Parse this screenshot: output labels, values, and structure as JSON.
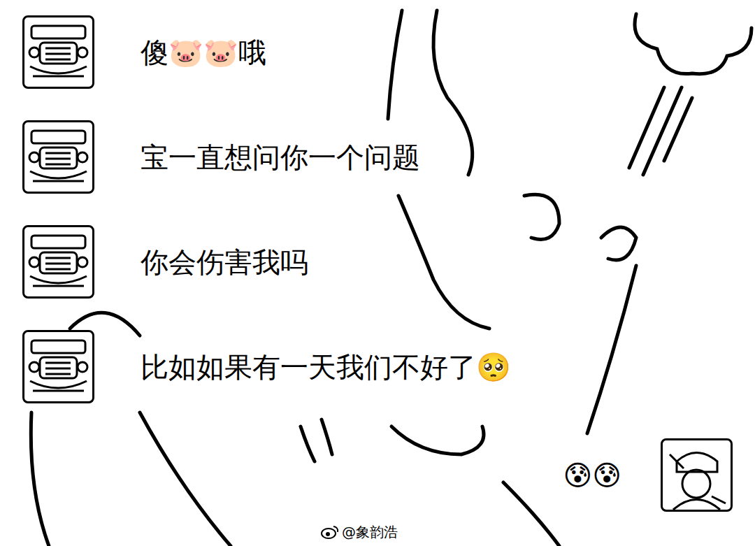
{
  "messages": [
    {
      "text": "傻🐷🐷哦",
      "kind": "received"
    },
    {
      "text": "宝一直想问你一个问题",
      "kind": "received"
    },
    {
      "text": "你会伤害我吗",
      "kind": "received"
    },
    {
      "text": "比如如果有一天我们不好了🥺",
      "kind": "received"
    },
    {
      "text": "😰😰",
      "kind": "sent"
    }
  ],
  "watermark": "@象韵浩"
}
